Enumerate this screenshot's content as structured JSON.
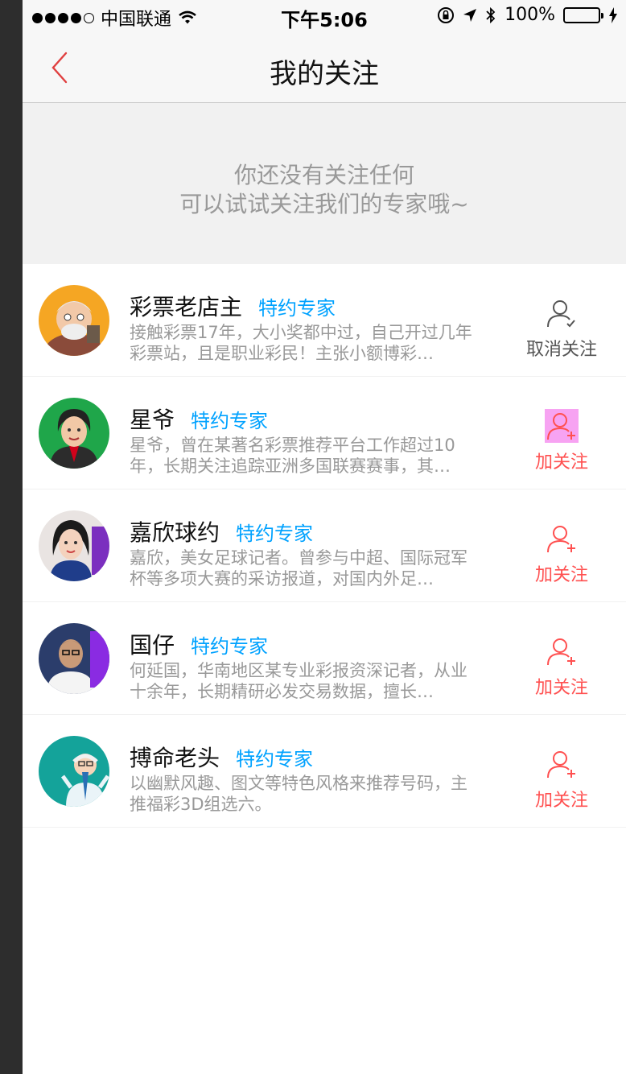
{
  "status_bar": {
    "carrier": "中国联通",
    "time": "下午5:06",
    "battery": "100%"
  },
  "nav": {
    "title": "我的关注"
  },
  "empty_notice": {
    "line1": "你还没有关注任何",
    "line2": "可以试试关注我们的专家哦~"
  },
  "colors": {
    "title_text": "#111111",
    "notice_text": "#999999",
    "tag_blue": "#00a2ff",
    "follow_red": "#ff5050",
    "unfollow_gray": "#555555",
    "divider": "#f1f1f1"
  },
  "experts": [
    {
      "name": "彩票老店主",
      "tag": "特约专家",
      "desc": "接触彩票17年，大小奖都中过，自己开过几年彩票站，且是职业彩民！主张小额博彩…",
      "action_label": "取消关注",
      "action_icon": "user-check-icon",
      "following": true
    },
    {
      "name": "星爷",
      "tag": "特约专家",
      "desc": "星爷，曾在某著名彩票推荐平台工作超过10年，长期关注追踪亚洲多国联赛赛事，其…",
      "action_label": "加关注",
      "action_icon": "user-plus-icon",
      "following": false
    },
    {
      "name": "嘉欣球约",
      "tag": "特约专家",
      "desc": "嘉欣，美女足球记者。曾参与中超、国际冠军杯等多项大赛的采访报道，对国内外足…",
      "action_label": "加关注",
      "action_icon": "user-plus-icon",
      "following": false
    },
    {
      "name": "国仔",
      "tag": "特约专家",
      "desc": "何延国，华南地区某专业彩报资深记者，从业十余年，长期精研必发交易数据，擅长…",
      "action_label": "加关注",
      "action_icon": "user-plus-icon",
      "following": false
    },
    {
      "name": "搏命老头",
      "tag": "特约专家",
      "desc": "以幽默风趣、图文等特色风格来推荐号码，主推福彩3D组选六。",
      "action_label": "加关注",
      "action_icon": "user-plus-icon",
      "following": false
    }
  ]
}
